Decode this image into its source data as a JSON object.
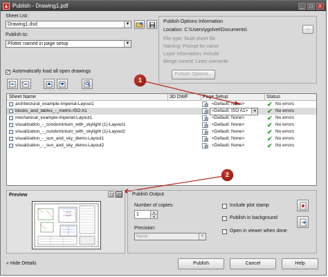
{
  "window": {
    "title": "Publish - Drawing1.pdf",
    "minimize": "_",
    "maximize": "□",
    "close": "X"
  },
  "sheet_list": {
    "label": "Sheet List:",
    "value": "Drawing1.dsd"
  },
  "publish_to": {
    "label": "Publish to:",
    "value": "Plotter named in page setup"
  },
  "publish_options": {
    "title": "Publish Options Information",
    "location": "Location: C:\\Users\\ygolvet\\Documents\\",
    "file_type": "File type: Multi-sheet file",
    "naming": "Naming: Prompt for name",
    "layer_information": "Layer information: Include",
    "merge_control": "Merge control: Lines overwrite",
    "browse_button": "...",
    "options_button": "Publish Options..."
  },
  "auto_load": {
    "label": "Automatically load all open drawings",
    "checked": true
  },
  "grid": {
    "headers": {
      "sheet_name": "Sheet Name",
      "dwf": "3D DWF",
      "page_setup": "Page Setup",
      "status": "Status"
    },
    "rows": [
      {
        "name": "architectural_example-imperial-Layout1",
        "page_setup": "<Default: None>",
        "status": "No errors",
        "selected": false,
        "dropdown": false
      },
      {
        "name": "blocks_and_tables_-_metric-ISO A1",
        "page_setup": "<Default: ISO A1>",
        "status": "No errors",
        "selected": true,
        "dropdown": true
      },
      {
        "name": "mechanical_example-imperial-Layout1",
        "page_setup": "<Default: None>",
        "status": "No errors",
        "selected": false,
        "dropdown": false
      },
      {
        "name": "visualization_-_condominium_with_skylight (1)-Layout1",
        "page_setup": "<Default: None>",
        "status": "No errors",
        "selected": false,
        "dropdown": false
      },
      {
        "name": "visualization_-_condominium_with_skylight (1)-Layout2",
        "page_setup": "<Default: None>",
        "status": "No errors",
        "selected": false,
        "dropdown": false
      },
      {
        "name": "visualization_-_sun_and_sky_demo-Layout1",
        "page_setup": "<Default: None>",
        "status": "No errors",
        "selected": false,
        "dropdown": false
      },
      {
        "name": "visualization_-_sun_and_sky_demo-Layout2",
        "page_setup": "<Default: None>",
        "status": "No errors",
        "selected": false,
        "dropdown": false
      }
    ]
  },
  "callouts": {
    "one": "1",
    "two": "2"
  },
  "preview": {
    "label": "Preview"
  },
  "publish_output": {
    "title": "Publish Output",
    "copies_label": "Number of copies:",
    "copies_value": "1",
    "precision_label": "Precision:",
    "precision_value": "None",
    "include_plot_stamp": {
      "label": "Include plot stamp",
      "checked": false
    },
    "publish_in_background": {
      "label": "Publish in background",
      "checked": false
    },
    "open_in_viewer": {
      "label": "Open in viewer when done",
      "checked": false
    }
  },
  "footer": {
    "hide_details": "Hide Details",
    "hide_details_arrow": "«",
    "publish": "Publish",
    "cancel": "Cancel",
    "help": "Help"
  },
  "colors": {
    "titlebar": "#3a3a3a",
    "callout": "#b5251a",
    "status_check": "#2e9a2e",
    "selected_row": "#dcdcdc"
  }
}
